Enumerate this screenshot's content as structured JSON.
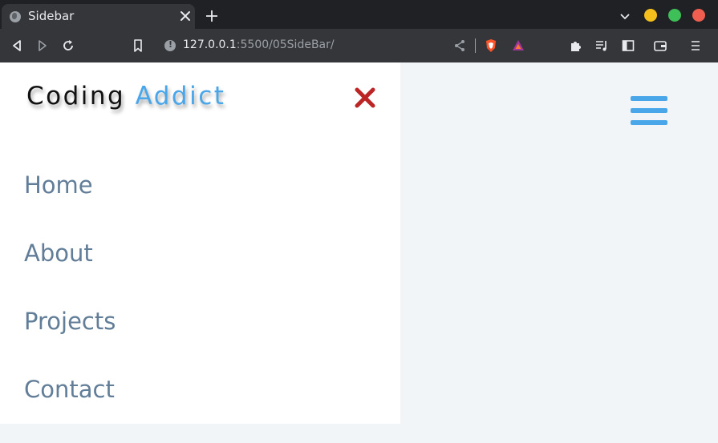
{
  "browser": {
    "tab": {
      "title": "Sidebar",
      "favicon": "globe-icon"
    },
    "url": {
      "host": "127.0.0.1",
      "rest": ":5500/05SideBar/"
    },
    "window_buttons": {
      "minimize_color": "#f5bf1c",
      "maximize_color": "#3fbf57",
      "close_color": "#ef5e4f"
    }
  },
  "sidebar": {
    "logo": {
      "part1": "Coding ",
      "part2": "Addict"
    },
    "close_icon": "close-x-icon",
    "links": [
      {
        "label": "Home"
      },
      {
        "label": "About"
      },
      {
        "label": "Projects"
      },
      {
        "label": "Contact"
      }
    ]
  },
  "toggle": {
    "icon": "hamburger-menu-icon"
  },
  "colors": {
    "accent": "#49a6e9",
    "close": "#bb2525",
    "link": "#617d98",
    "page_bg": "#f1f5f8",
    "sidebar_bg": "#ffffff"
  }
}
